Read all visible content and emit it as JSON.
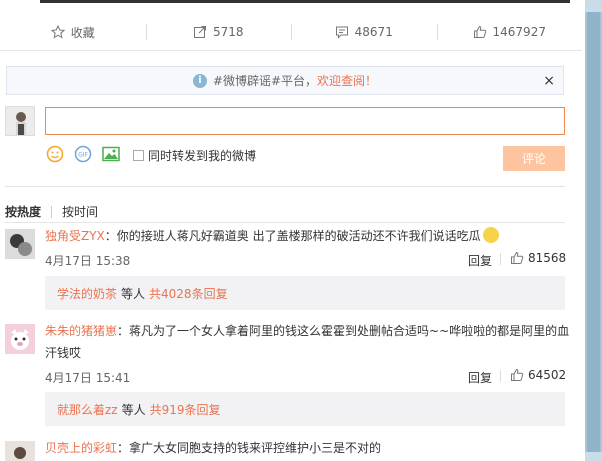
{
  "actions": {
    "favorite": "收藏",
    "repost": "5718",
    "comment": "48671",
    "like": "1467927"
  },
  "notice": {
    "tag": "#微博辟谣#平台，",
    "highlight": "欢迎查阅！",
    "close": "×"
  },
  "composer": {
    "forward_label": "同时转发到我的微博",
    "submit_label": "评论"
  },
  "sort": {
    "hot": "按热度",
    "time": "按时间"
  },
  "comments": [
    {
      "user": "独角受ZYX",
      "text": "：你的接班人蒋凡好霸道奥 出了盖楼那样的破活动还不许我们说话吃瓜",
      "time": "4月17日 15:38",
      "reply": "回复",
      "likes": "81568",
      "sub_user": "学法的奶茶",
      "sub_mid": "等人",
      "sub_count": "共4028条回复"
    },
    {
      "user": "朱朱的猪猪崽",
      "text": "：蒋凡为了一个女人拿着阿里的钱这么霍霍到处删帖合适吗~~哗啦啦的都是阿里的血汗钱哎",
      "time": "4月17日 15:41",
      "reply": "回复",
      "likes": "64502",
      "sub_user": "就那么着zz",
      "sub_mid": "等人",
      "sub_count": "共919条回复"
    },
    {
      "user": "贝壳上的彩虹",
      "text": "：拿广大女同胞支持的钱来评控维护小三是不对的"
    }
  ]
}
